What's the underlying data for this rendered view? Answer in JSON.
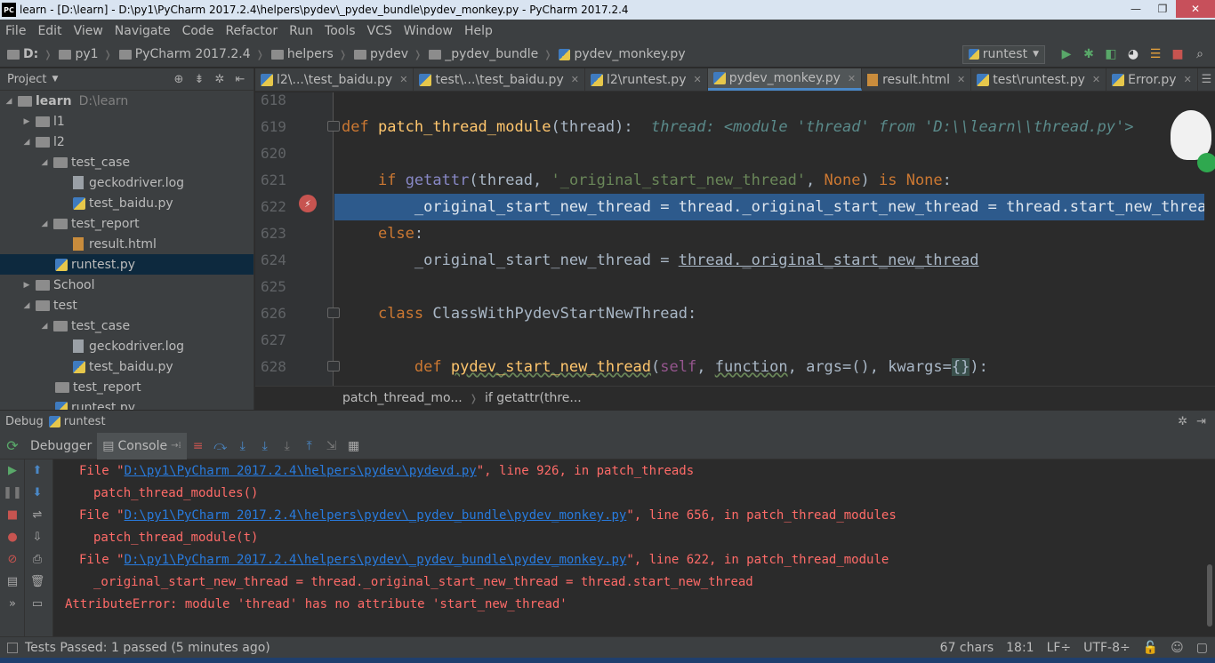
{
  "window": {
    "title": "learn - [D:\\learn] - D:\\py1\\PyCharm 2017.2.4\\helpers\\pydev\\_pydev_bundle\\pydev_monkey.py - PyCharm 2017.2.4",
    "logo_text": "PC",
    "minimize": "—",
    "maximize": "❐",
    "close": "✕"
  },
  "menu": [
    "File",
    "Edit",
    "View",
    "Navigate",
    "Code",
    "Refactor",
    "Run",
    "Tools",
    "VCS",
    "Window",
    "Help"
  ],
  "navbar": {
    "crumbs": [
      "D:",
      "py1",
      "PyCharm 2017.2.4",
      "helpers",
      "pydev",
      "_pydev_bundle",
      "pydev_monkey.py"
    ],
    "run_config": "runtest"
  },
  "project": {
    "header": "Project",
    "tree": [
      {
        "label": "learn",
        "hint": "D:\\learn"
      },
      {
        "label": "l1"
      },
      {
        "label": "l2"
      },
      {
        "label": "test_case"
      },
      {
        "label": "geckodriver.log"
      },
      {
        "label": "test_baidu.py"
      },
      {
        "label": "test_report"
      },
      {
        "label": "result.html"
      },
      {
        "label": "runtest.py"
      },
      {
        "label": "School"
      },
      {
        "label": "test"
      },
      {
        "label": "test_case"
      },
      {
        "label": "geckodriver.log"
      },
      {
        "label": "test_baidu.py"
      },
      {
        "label": "test_report"
      },
      {
        "label": "runtest.py"
      }
    ]
  },
  "tabs": [
    {
      "label": "l2\\...\\test_baidu.py"
    },
    {
      "label": "test\\...\\test_baidu.py"
    },
    {
      "label": "l2\\runtest.py"
    },
    {
      "label": "pydev_monkey.py"
    },
    {
      "label": "result.html"
    },
    {
      "label": "test\\runtest.py"
    },
    {
      "label": "Error.py"
    }
  ],
  "tabs_overflow": "☰",
  "editor": {
    "line_numbers": [
      "618",
      "619",
      "620",
      "621",
      "622",
      "623",
      "624",
      "625",
      "626",
      "627",
      "628"
    ],
    "line619_def": "def",
    "line619_fn": "patch_thread_module",
    "line619_params": "(thread):",
    "line619_hint": "thread: <module 'thread' from 'D:\\\\learn\\\\thread.py'>",
    "line621_if": "if",
    "line621_call": "getattr",
    "line621_open": "(thread, ",
    "line621_str": "'_original_start_new_thread'",
    "line621_comma": ", ",
    "line621_none": "None",
    "line621_close": ") ",
    "line621_is": "is",
    "line621_space": " ",
    "line621_none2": "None",
    "line621_colon": ":",
    "line622": "_original_start_new_thread = thread._original_start_new_thread = thread.start_new_thread",
    "line623_else": "else",
    "line623_colon": ":",
    "line624_a": "_original_start_new_thread = ",
    "line624_b": "thread._original_start_new_thread",
    "line626_class": "class",
    "line626_name": "ClassWithPydevStartNewThread:",
    "line628_def": "def",
    "line628_fn": "pydev_start_new_thread",
    "line628_open": "(",
    "line628_self": "self",
    "line628_comma": ", ",
    "line628_function": "function",
    "line628_rest": ", args=(), kwargs=",
    "line628_brace": "{}",
    "line628_end": "):",
    "breadcrumb": [
      "patch_thread_mo...",
      "if getattr(thre..."
    ]
  },
  "debug": {
    "label": "Debug",
    "config": "runtest",
    "tabs": [
      "Debugger",
      "Console"
    ]
  },
  "console": {
    "l1_pre": "File \"",
    "l1_link": "D:\\py1\\PyCharm 2017.2.4\\helpers\\pydev\\pydevd.py",
    "l1_post": "\", line 926, in patch_threads",
    "l2": "patch_thread_modules()",
    "l3_pre": "File \"",
    "l3_link": "D:\\py1\\PyCharm 2017.2.4\\helpers\\pydev\\_pydev_bundle\\pydev_monkey.py",
    "l3_post": "\", line 656, in patch_thread_modules",
    "l4": "patch_thread_module(t)",
    "l5_pre": "File \"",
    "l5_link": "D:\\py1\\PyCharm 2017.2.4\\helpers\\pydev\\_pydev_bundle\\pydev_monkey.py",
    "l5_post": "\", line 622, in patch_thread_module",
    "l6": "_original_start_new_thread = thread._original_start_new_thread = thread.start_new_thread",
    "l7": "AttributeError: module 'thread' has no attribute 'start_new_thread'"
  },
  "status": {
    "message": "Tests Passed: 1 passed (5 minutes ago)",
    "chars": "67 chars",
    "position": "18:1",
    "line_sep": "LF÷",
    "encoding": "UTF-8÷"
  },
  "colors": {
    "background": "#2b2b2b",
    "panel": "#3c3f41",
    "selection": "#2d5a8c",
    "error": "#ff6b68",
    "link": "#287bde",
    "keyword": "#cc7832"
  }
}
